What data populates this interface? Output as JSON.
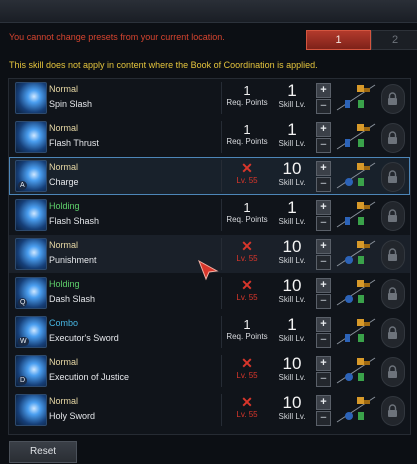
{
  "messages": {
    "location_warning": "You cannot change presets from your current location.",
    "coordination_warning": "This skill does not apply in content where the Book of Coordination is applied."
  },
  "presets": [
    {
      "label": "1",
      "selected": true
    },
    {
      "label": "2",
      "selected": false
    }
  ],
  "labels": {
    "req_points": "Req. Points",
    "skill_lv": "Skill Lv.",
    "plus": "+",
    "minus": "−"
  },
  "skills": [
    {
      "type": "Normal",
      "name": "Spin Slash",
      "req_points": "1",
      "locked_text": "",
      "skill_level": "1",
      "key": ""
    },
    {
      "type": "Normal",
      "name": "Flash Thrust",
      "req_points": "1",
      "locked_text": "",
      "skill_level": "1",
      "key": ""
    },
    {
      "type": "Normal",
      "name": "Charge",
      "req_points": "",
      "locked_text": "Lv. 55",
      "skill_level": "10",
      "key": "A"
    },
    {
      "type": "Holding",
      "name": "Flash Shash",
      "req_points": "1",
      "locked_text": "",
      "skill_level": "1",
      "key": ""
    },
    {
      "type": "Normal",
      "name": "Punishment",
      "req_points": "",
      "locked_text": "Lv. 55",
      "skill_level": "10",
      "key": ""
    },
    {
      "type": "Holding",
      "name": "Dash Slash",
      "req_points": "",
      "locked_text": "Lv. 55",
      "skill_level": "10",
      "key": "Q"
    },
    {
      "type": "Combo",
      "name": "Executor's Sword",
      "req_points": "1",
      "locked_text": "",
      "skill_level": "1",
      "key": "W"
    },
    {
      "type": "Normal",
      "name": "Execution of Justice",
      "req_points": "",
      "locked_text": "Lv. 55",
      "skill_level": "10",
      "key": "D"
    },
    {
      "type": "Normal",
      "name": "Holy Sword",
      "req_points": "",
      "locked_text": "Lv. 55",
      "skill_level": "10",
      "key": ""
    }
  ],
  "footer": {
    "reset_label": "Reset"
  },
  "colors": {
    "accent_red": "#d6442f",
    "warning_yellow": "#e5c53d",
    "holding_green": "#5ed16b",
    "combo_blue": "#47b7e4",
    "normal_gold": "#e8d9a6"
  }
}
